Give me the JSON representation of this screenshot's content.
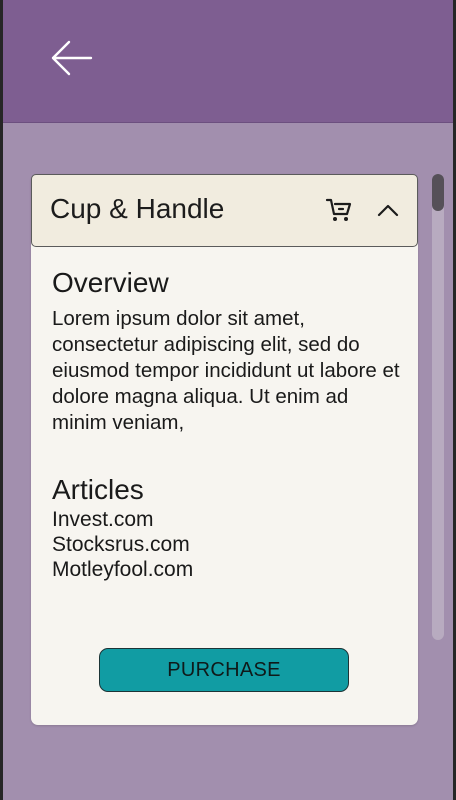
{
  "app": {
    "colors": {
      "app_bar": "#7e5e91",
      "background": "#a28fae",
      "card": "#f7f5f0",
      "card_header": "#f1ecdf",
      "accent": "#119ca3"
    }
  },
  "header": {
    "back_icon": "arrow-left-icon"
  },
  "card": {
    "title": "Cup & Handle",
    "cart_icon": "shopping-cart-icon",
    "collapse_icon": "chevron-up-icon",
    "overview": {
      "heading": "Overview",
      "body": "Lorem ipsum dolor sit amet, consectetur adipiscing elit, sed do eiusmod tempor incididunt ut labore et dolore magna aliqua. Ut enim ad minim veniam,"
    },
    "articles": {
      "heading": "Articles",
      "items": [
        "Invest.com",
        "Stocksrus.com",
        "Motleyfool.com"
      ]
    },
    "purchase_label": "PURCHASE"
  }
}
